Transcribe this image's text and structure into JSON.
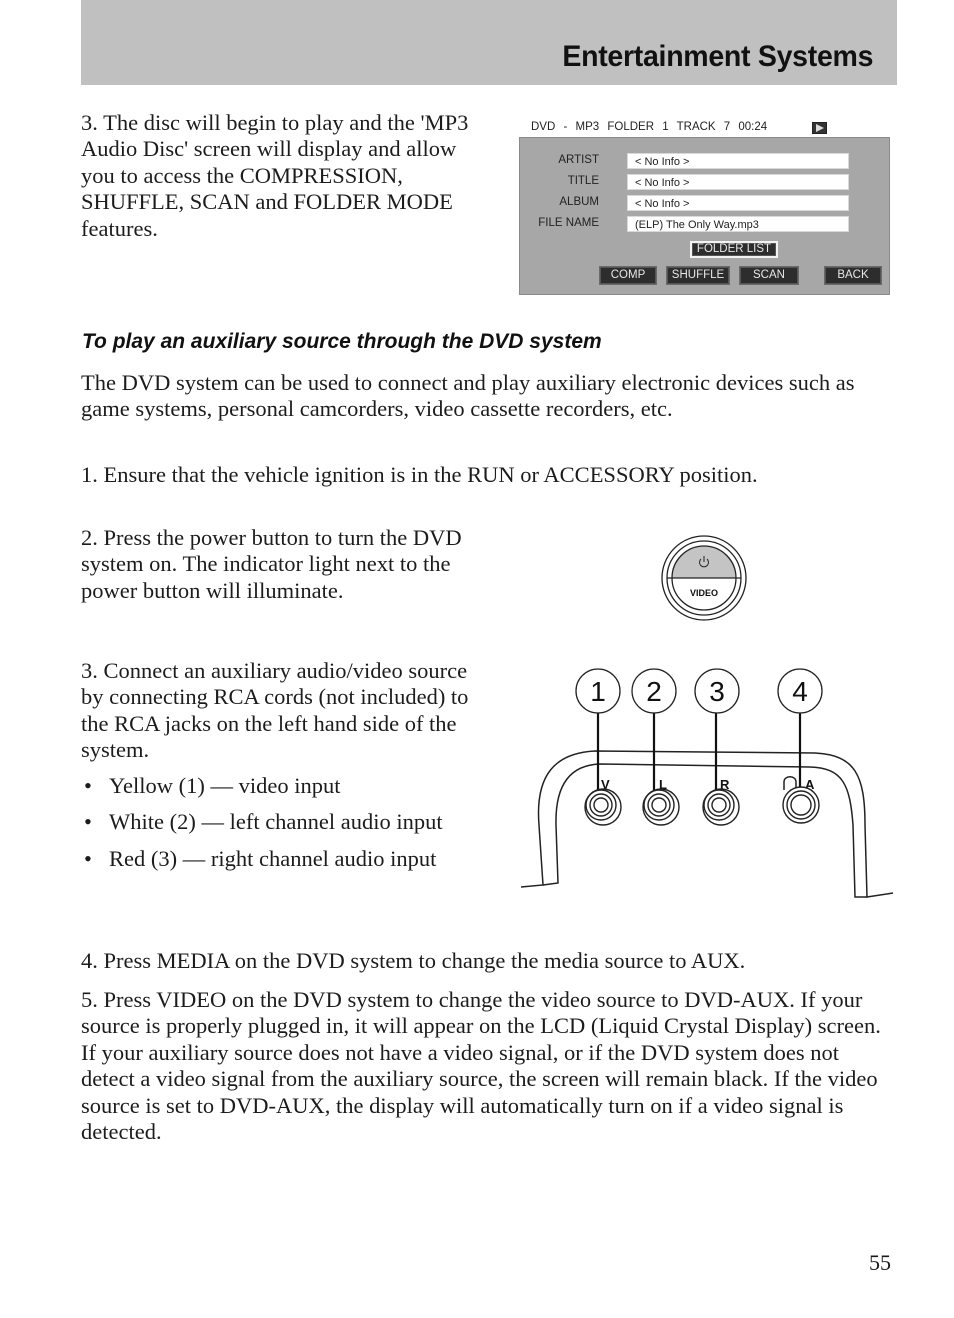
{
  "header": {
    "title": "Entertainment Systems"
  },
  "intro_step3": "3. The disc will begin to play and the 'MP3 Audio Disc' screen will display and allow you to access the COMPRESSION, SHUFFLE, SCAN and FOLDER MODE features.",
  "mp3_screen": {
    "status_bar": {
      "source": "DVD - MP3",
      "folder": "FOLDER 1",
      "track": "TRACK 7",
      "time": "00:24",
      "play_icon": "play-icon"
    },
    "fields": [
      {
        "label": "ARTIST",
        "value": "< No Info >"
      },
      {
        "label": "TITLE",
        "value": "< No Info >"
      },
      {
        "label": "ALBUM",
        "value": "< No Info >"
      },
      {
        "label": "FILE NAME",
        "value": "(ELP) The Only Way.mp3"
      }
    ],
    "folder_list_button": "FOLDER LIST",
    "buttons": [
      "COMP",
      "SHUFFLE",
      "SCAN",
      "BACK"
    ]
  },
  "section": {
    "heading": "To play an auxiliary source through the DVD system",
    "intro": "The DVD system can be used to connect and play auxiliary electronic devices such as game systems, personal camcorders, video cassette recorders, etc.",
    "step1": "1. Ensure that the vehicle ignition is in the RUN or ACCESSORY position.",
    "step2": "2. Press the power button to turn the DVD system on. The indicator light next to the power button will illuminate.",
    "step3": "3. Connect an auxiliary audio/video source by connecting RCA cords (not included) to the RCA jacks on the left hand side of the system.",
    "bullets": [
      "Yellow (1) — video input",
      "White (2) — left channel audio input",
      "Red (3) — right channel audio input"
    ],
    "step4": "4. Press MEDIA on the DVD system to change the media source to AUX.",
    "step5": "5. Press VIDEO on the DVD system to change the video source to DVD-AUX. If your source is properly plugged in, it will appear on the LCD (Liquid Crystal Display) screen. If your auxiliary source does not have a video signal, or if the DVD system does not detect a video signal from the auxiliary source, the screen will remain black. If the video source is set to DVD-AUX, the display will automatically turn on if a video signal is detected."
  },
  "video_button": {
    "label": "VIDEO",
    "icon": "power-icon"
  },
  "jack_panel": {
    "callouts": [
      "1",
      "2",
      "3",
      "4"
    ],
    "jack_labels": [
      "V",
      "L",
      "R",
      "A"
    ],
    "headphone_icon": "headphone-icon"
  },
  "bullet_glyph": "•",
  "page_number": "55"
}
